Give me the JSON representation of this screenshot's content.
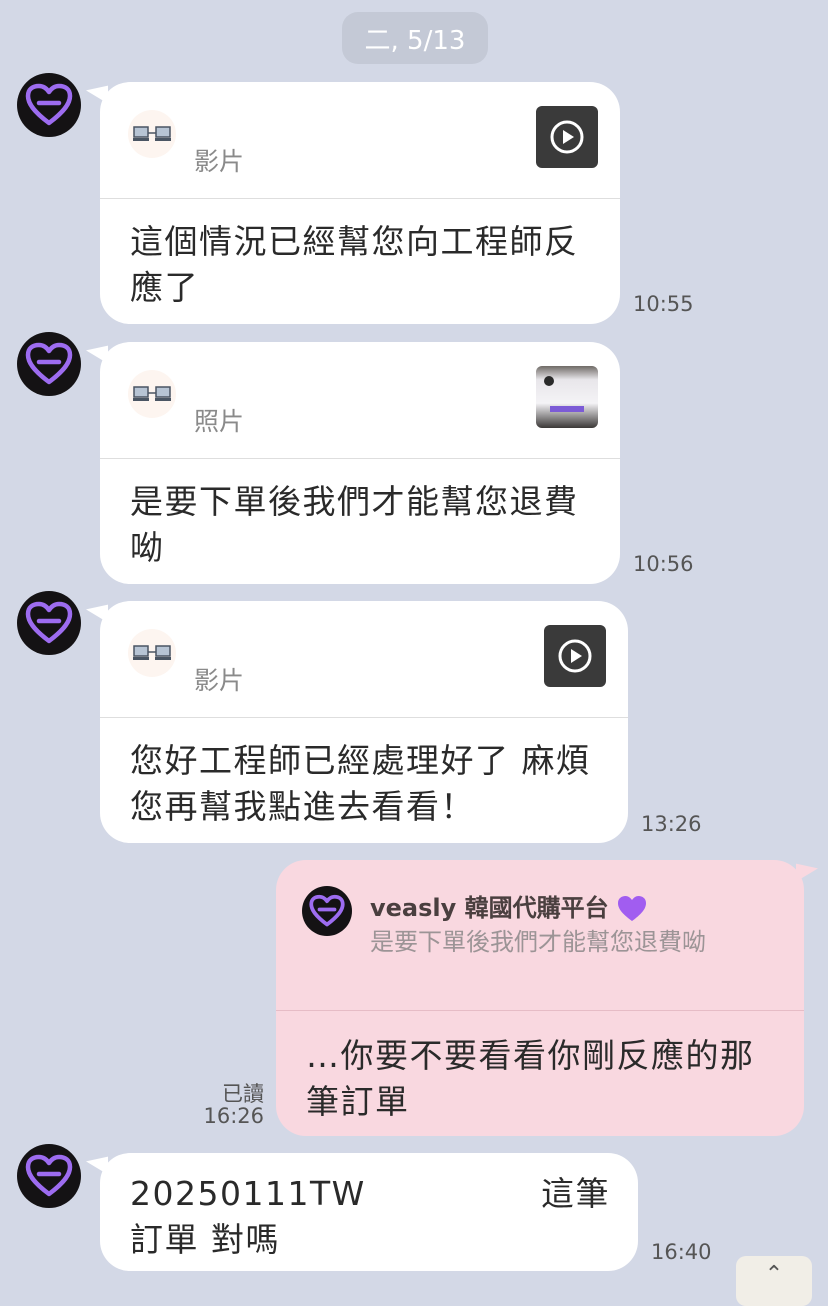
{
  "date_separator": "二, 5/13",
  "icons": {
    "avatar": "purple-heart-icon",
    "attachment": "computer-link-icon",
    "video": "play-icon",
    "emoji": "purple-heart-emoji",
    "scroll": "chevron-up-icon"
  },
  "colors": {
    "background": "#d3d8e6",
    "incoming_bubble": "#ffffff",
    "outgoing_bubble": "#f9d8e0",
    "brand_purple": "#9d6cf0"
  },
  "messages": [
    {
      "quote_label": "影片",
      "text": "這個情況已經幫您向工程師反應了",
      "line1": "這個情況已經幫您向工程師反",
      "line2": "應了",
      "time": "10:55"
    },
    {
      "quote_label": "照片",
      "text": "是要下單後我們才能幫您退費呦",
      "line1": "是要下單後我們才能幫您退費",
      "line2": "呦",
      "time": "10:56"
    },
    {
      "quote_label": "影片",
      "text": "您好工程師已經處理好了 麻煩您再幫我點進去看看！",
      "line1": "您好工程師已經處理好了 麻煩",
      "line2": "您再幫我點進去看看！",
      "time": "13:26"
    },
    {
      "direction": "outgoing",
      "reply_to_name": "veasly 韓國代購平台",
      "reply_to_text": "是要下單後我們才能幫您退費呦",
      "text": "…你要不要看看你剛反應的那筆訂單",
      "line1": "…你要不要看看你剛反應的那",
      "line2": "筆訂單",
      "read_status": "已讀",
      "time": "16:26"
    },
    {
      "text_left": "20250111TW",
      "text_right": "這筆",
      "line2": "訂單 對嗎",
      "time": "16:40"
    }
  ]
}
